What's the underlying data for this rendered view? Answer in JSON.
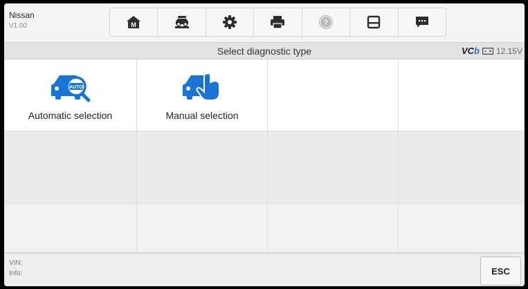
{
  "header": {
    "vehicle": "Nissan",
    "version": "V1.00"
  },
  "toolbar": {
    "buttons": [
      {
        "icon": "home-icon",
        "badge": "M"
      },
      {
        "icon": "vehicle-lift-icon"
      },
      {
        "icon": "settings-icon"
      },
      {
        "icon": "print-icon"
      },
      {
        "icon": "help-icon"
      },
      {
        "icon": "save-icon"
      },
      {
        "icon": "message-icon"
      }
    ]
  },
  "titlebar": {
    "title": "Select diagnostic type",
    "vcb_prefix": "VC",
    "vcb_suffix": "b",
    "voltage": "12.15V"
  },
  "options": [
    {
      "label": "Automatic selection",
      "icon": "car-auto-search-icon",
      "icon_text": "AUTO"
    },
    {
      "label": "Manual selection",
      "icon": "car-manual-hand-icon"
    }
  ],
  "footer": {
    "vin_label": "VIN:",
    "info_label": "Info:",
    "esc_label": "ESC"
  },
  "colors": {
    "accent": "#1a73d6",
    "icon_dark": "#2d2d2d",
    "help_gray": "#b8b8b8"
  }
}
